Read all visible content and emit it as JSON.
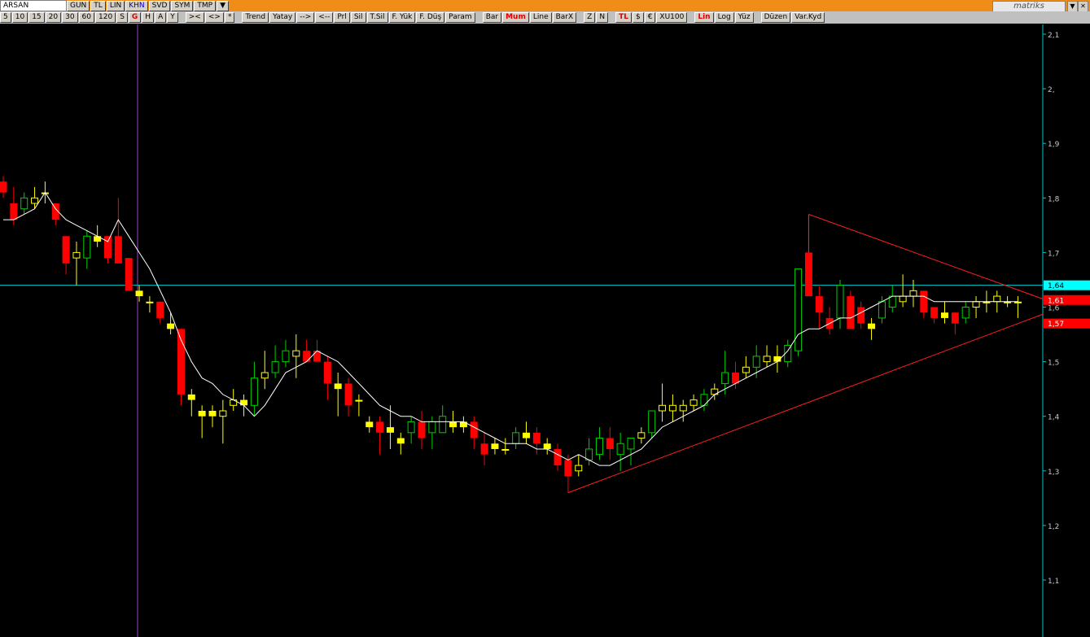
{
  "toolbar": {
    "symbol": "ARSAN",
    "row1_buttons": [
      "GUN",
      "TL",
      "LIN",
      "KHN",
      "SVD",
      "SYM",
      "TMP",
      "▼"
    ],
    "period_buttons": [
      "5",
      "10",
      "15",
      "20",
      "30",
      "60",
      "120",
      "S",
      "G",
      "H",
      "A",
      "Y"
    ],
    "nav_buttons": [
      ">< ",
      "<>",
      "*"
    ],
    "draw_buttons": [
      "Trend",
      "Yatay",
      "-->",
      "<--",
      "Prl",
      "Sil",
      "T.Sil",
      "F. Yük",
      "F. Düş",
      "Param"
    ],
    "type_buttons": [
      "Bar",
      "Mum",
      "Line",
      "BarX"
    ],
    "zoom_buttons": [
      "Z",
      "N"
    ],
    "currency_buttons": [
      "TL",
      "$",
      "€",
      "XU100"
    ],
    "scale_buttons": [
      "Lin",
      "Log",
      "Yüz"
    ],
    "extra_buttons": [
      "Düzen",
      "Var.Kyd"
    ],
    "brand": "matriks"
  },
  "colors": {
    "up": "#00d000",
    "down": "#ff0000",
    "neutral": "#ffff00",
    "ma": "#ffffff",
    "axis": "#00c8c8",
    "trend": "#ff2020"
  },
  "chart_data": {
    "type": "candlestick",
    "y_ticks": [
      "2,1",
      "2,",
      "1,9",
      "1,8",
      "1,7",
      "1,6",
      "1,5",
      "1,4",
      "1,3",
      "1,2",
      "1,1"
    ],
    "ylim": [
      1.0,
      2.1
    ],
    "horizontal_line": 1.64,
    "price_labels": [
      {
        "text": "1,64",
        "value": 1.64,
        "bg": "#00ffff"
      },
      {
        "text": "1,61",
        "value": 1.613,
        "bg": "#ff0000"
      },
      {
        "text": "1,57",
        "value": 1.57,
        "bg": "#ff0000"
      }
    ],
    "candles": [
      [
        1.83,
        1.84,
        1.8,
        1.81
      ],
      [
        1.79,
        1.82,
        1.75,
        1.76
      ],
      [
        1.78,
        1.81,
        1.77,
        1.8
      ],
      [
        1.79,
        1.82,
        1.78,
        1.8
      ],
      [
        1.81,
        1.83,
        1.79,
        1.81
      ],
      [
        1.79,
        1.79,
        1.75,
        1.76
      ],
      [
        1.73,
        1.73,
        1.66,
        1.68
      ],
      [
        1.69,
        1.72,
        1.64,
        1.7
      ],
      [
        1.69,
        1.74,
        1.67,
        1.73
      ],
      [
        1.73,
        1.75,
        1.71,
        1.72
      ],
      [
        1.73,
        1.73,
        1.68,
        1.69
      ],
      [
        1.73,
        1.8,
        1.7,
        1.68
      ],
      [
        1.69,
        1.69,
        1.63,
        1.63
      ],
      [
        1.63,
        1.64,
        1.61,
        1.62
      ],
      [
        1.61,
        1.62,
        1.59,
        1.61
      ],
      [
        1.61,
        1.61,
        1.57,
        1.58
      ],
      [
        1.57,
        1.59,
        1.55,
        1.56
      ],
      [
        1.56,
        1.56,
        1.42,
        1.44
      ],
      [
        1.44,
        1.45,
        1.4,
        1.43
      ],
      [
        1.41,
        1.42,
        1.36,
        1.4
      ],
      [
        1.41,
        1.42,
        1.38,
        1.4
      ],
      [
        1.4,
        1.43,
        1.35,
        1.41
      ],
      [
        1.42,
        1.45,
        1.41,
        1.43
      ],
      [
        1.43,
        1.44,
        1.4,
        1.42
      ],
      [
        1.42,
        1.5,
        1.4,
        1.47
      ],
      [
        1.47,
        1.52,
        1.45,
        1.48
      ],
      [
        1.48,
        1.53,
        1.47,
        1.5
      ],
      [
        1.5,
        1.54,
        1.49,
        1.52
      ],
      [
        1.51,
        1.55,
        1.47,
        1.52
      ],
      [
        1.52,
        1.54,
        1.51,
        1.5
      ],
      [
        1.52,
        1.54,
        1.5,
        1.5
      ],
      [
        1.5,
        1.51,
        1.43,
        1.46
      ],
      [
        1.46,
        1.48,
        1.4,
        1.45
      ],
      [
        1.46,
        1.47,
        1.4,
        1.42
      ],
      [
        1.43,
        1.44,
        1.4,
        1.43
      ],
      [
        1.39,
        1.4,
        1.37,
        1.38
      ],
      [
        1.39,
        1.4,
        1.33,
        1.37
      ],
      [
        1.38,
        1.42,
        1.34,
        1.37
      ],
      [
        1.36,
        1.37,
        1.33,
        1.35
      ],
      [
        1.37,
        1.4,
        1.35,
        1.39
      ],
      [
        1.39,
        1.41,
        1.34,
        1.36
      ],
      [
        1.37,
        1.4,
        1.34,
        1.39
      ],
      [
        1.37,
        1.42,
        1.37,
        1.4
      ],
      [
        1.39,
        1.41,
        1.37,
        1.38
      ],
      [
        1.39,
        1.4,
        1.37,
        1.38
      ],
      [
        1.39,
        1.4,
        1.34,
        1.36
      ],
      [
        1.35,
        1.37,
        1.31,
        1.33
      ],
      [
        1.35,
        1.36,
        1.33,
        1.34
      ],
      [
        1.34,
        1.36,
        1.33,
        1.34
      ],
      [
        1.35,
        1.38,
        1.34,
        1.37
      ],
      [
        1.37,
        1.39,
        1.35,
        1.36
      ],
      [
        1.37,
        1.38,
        1.33,
        1.35
      ],
      [
        1.35,
        1.36,
        1.33,
        1.34
      ],
      [
        1.34,
        1.35,
        1.3,
        1.31
      ],
      [
        1.32,
        1.33,
        1.26,
        1.29
      ],
      [
        1.3,
        1.33,
        1.29,
        1.31
      ],
      [
        1.32,
        1.36,
        1.31,
        1.34
      ],
      [
        1.33,
        1.38,
        1.32,
        1.36
      ],
      [
        1.36,
        1.38,
        1.32,
        1.34
      ],
      [
        1.33,
        1.37,
        1.3,
        1.35
      ],
      [
        1.34,
        1.36,
        1.31,
        1.36
      ],
      [
        1.36,
        1.38,
        1.35,
        1.37
      ],
      [
        1.37,
        1.41,
        1.36,
        1.41
      ],
      [
        1.41,
        1.46,
        1.39,
        1.42
      ],
      [
        1.41,
        1.44,
        1.39,
        1.42
      ],
      [
        1.41,
        1.43,
        1.39,
        1.42
      ],
      [
        1.42,
        1.44,
        1.41,
        1.43
      ],
      [
        1.42,
        1.45,
        1.41,
        1.44
      ],
      [
        1.44,
        1.46,
        1.43,
        1.45
      ],
      [
        1.46,
        1.52,
        1.44,
        1.48
      ],
      [
        1.48,
        1.5,
        1.45,
        1.46
      ],
      [
        1.48,
        1.51,
        1.47,
        1.49
      ],
      [
        1.49,
        1.53,
        1.47,
        1.51
      ],
      [
        1.5,
        1.53,
        1.49,
        1.51
      ],
      [
        1.51,
        1.53,
        1.48,
        1.5
      ],
      [
        1.5,
        1.54,
        1.49,
        1.53
      ],
      [
        1.52,
        1.67,
        1.51,
        1.67
      ],
      [
        1.7,
        1.77,
        1.62,
        1.62
      ],
      [
        1.62,
        1.64,
        1.56,
        1.59
      ],
      [
        1.58,
        1.6,
        1.55,
        1.56
      ],
      [
        1.58,
        1.65,
        1.56,
        1.64
      ],
      [
        1.62,
        1.63,
        1.56,
        1.56
      ],
      [
        1.6,
        1.61,
        1.56,
        1.57
      ],
      [
        1.57,
        1.58,
        1.54,
        1.56
      ],
      [
        1.58,
        1.62,
        1.57,
        1.61
      ],
      [
        1.6,
        1.64,
        1.59,
        1.62
      ],
      [
        1.61,
        1.66,
        1.6,
        1.62
      ],
      [
        1.62,
        1.65,
        1.6,
        1.63
      ],
      [
        1.63,
        1.63,
        1.58,
        1.59
      ],
      [
        1.6,
        1.6,
        1.57,
        1.58
      ],
      [
        1.59,
        1.61,
        1.57,
        1.58
      ],
      [
        1.59,
        1.59,
        1.55,
        1.57
      ],
      [
        1.58,
        1.61,
        1.57,
        1.6
      ],
      [
        1.6,
        1.62,
        1.58,
        1.61
      ],
      [
        1.61,
        1.63,
        1.59,
        1.61
      ],
      [
        1.61,
        1.63,
        1.59,
        1.62
      ],
      [
        1.61,
        1.62,
        1.6,
        1.61
      ],
      [
        1.61,
        1.62,
        1.58,
        1.61
      ]
    ],
    "ma": [
      1.76,
      1.76,
      1.77,
      1.78,
      1.81,
      1.78,
      1.76,
      1.75,
      1.74,
      1.73,
      1.72,
      1.76,
      1.73,
      1.7,
      1.67,
      1.63,
      1.59,
      1.54,
      1.5,
      1.47,
      1.46,
      1.44,
      1.43,
      1.42,
      1.4,
      1.42,
      1.45,
      1.48,
      1.49,
      1.5,
      1.52,
      1.51,
      1.5,
      1.48,
      1.46,
      1.44,
      1.42,
      1.41,
      1.4,
      1.4,
      1.39,
      1.39,
      1.39,
      1.39,
      1.39,
      1.38,
      1.37,
      1.36,
      1.35,
      1.35,
      1.35,
      1.34,
      1.34,
      1.33,
      1.32,
      1.33,
      1.32,
      1.31,
      1.31,
      1.32,
      1.33,
      1.34,
      1.36,
      1.38,
      1.39,
      1.4,
      1.41,
      1.42,
      1.44,
      1.45,
      1.46,
      1.47,
      1.48,
      1.49,
      1.5,
      1.52,
      1.55,
      1.56,
      1.56,
      1.57,
      1.58,
      1.58,
      1.59,
      1.6,
      1.61,
      1.62,
      1.62,
      1.62,
      1.62,
      1.61,
      1.61,
      1.61,
      1.61,
      1.61,
      1.61,
      1.61,
      1.61,
      1.61
    ]
  }
}
